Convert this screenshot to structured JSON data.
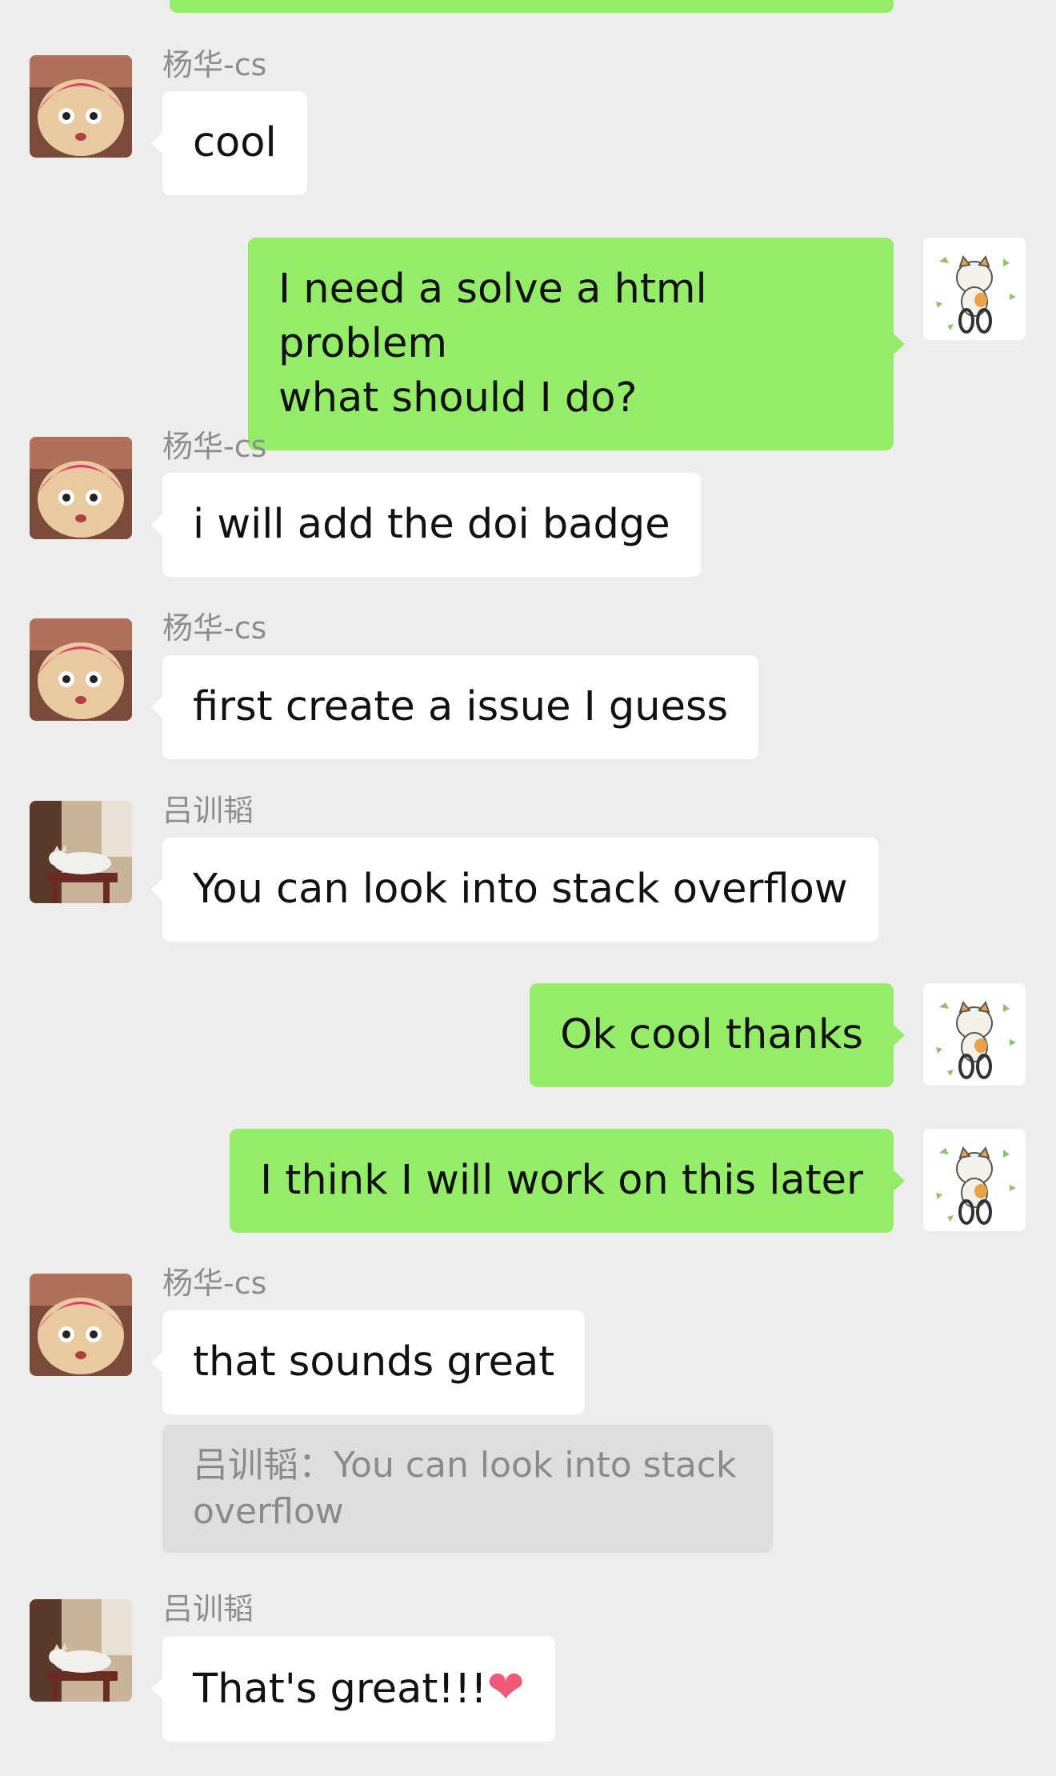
{
  "messages": [
    {
      "sender": "杨华-cs",
      "direction": "in",
      "avatar": "crayon-shin-chan-plush-avatar",
      "text": "cool"
    },
    {
      "direction": "out",
      "avatar": "cat-on-bicycle-avatar",
      "lines": [
        "I need a solve a html problem",
        "what should I do?"
      ]
    },
    {
      "sender": "杨华-cs",
      "direction": "in",
      "avatar": "crayon-shin-chan-plush-avatar",
      "text": "i will add the doi badge"
    },
    {
      "sender": "杨华-cs",
      "direction": "in",
      "avatar": "crayon-shin-chan-plush-avatar",
      "text": "first create a issue I guess"
    },
    {
      "sender": "吕训韬",
      "direction": "in",
      "avatar": "sleeping-cat-avatar",
      "text": "You can look into stack overflow"
    },
    {
      "direction": "out",
      "avatar": "cat-on-bicycle-avatar",
      "text": "Ok cool thanks"
    },
    {
      "direction": "out",
      "avatar": "cat-on-bicycle-avatar",
      "text": "I think I will work on this later"
    },
    {
      "sender": "杨华-cs",
      "direction": "in",
      "avatar": "crayon-shin-chan-plush-avatar",
      "text": "that sounds great",
      "quote": {
        "lines": [
          "吕训韬：You can look into stack",
          "overflow"
        ]
      }
    },
    {
      "sender": "吕训韬",
      "direction": "in",
      "avatar": "sleeping-cat-avatar",
      "text": "That's great!!!",
      "emoji": "❤"
    }
  ],
  "colors": {
    "background": "#ededed",
    "outgoing_bubble": "#95ec69",
    "incoming_bubble": "#ffffff",
    "sender_name": "#8d8d8d"
  }
}
